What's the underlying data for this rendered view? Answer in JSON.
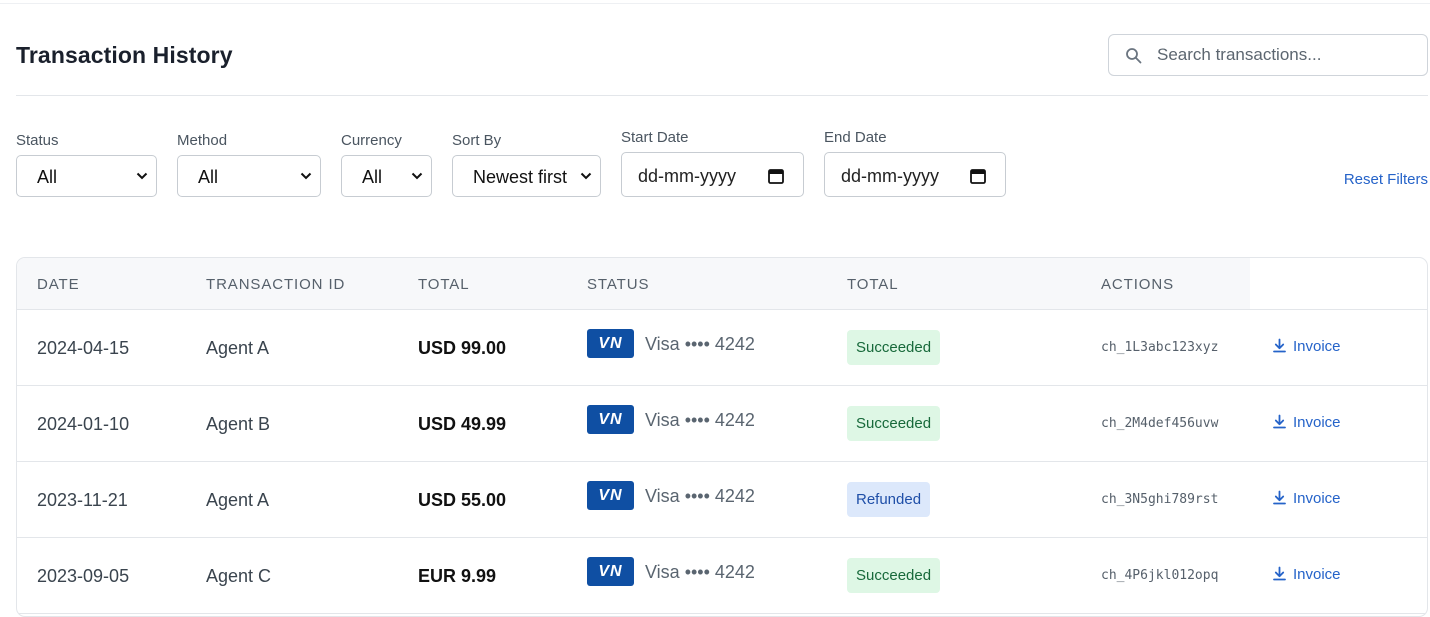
{
  "header": {
    "title": "Transaction History",
    "search_placeholder": "Search transactions..."
  },
  "filters": {
    "status": {
      "label": "Status",
      "value": "All"
    },
    "method": {
      "label": "Method",
      "value": "All"
    },
    "currency": {
      "label": "Currency",
      "value": "All"
    },
    "sort": {
      "label": "Sort By",
      "value": "Newest first"
    },
    "start_date": {
      "label": "Start Date",
      "value": "dd-mm-yyyy"
    },
    "end_date": {
      "label": "End Date",
      "value": "dd-mm-yyyy"
    },
    "reset_label": "Reset Filters"
  },
  "table": {
    "columns": [
      "DATE",
      "TRANSACTION ID",
      "TOTAL",
      "STATUS",
      "TOTAL",
      "ACTIONS"
    ],
    "rows": [
      {
        "date": "2024-04-15",
        "agent": "Agent A",
        "total": "USD 99.00",
        "card_brand": "VN",
        "card": "Visa •••• 4242",
        "status": "Succeeded",
        "charge_id": "ch_1L3abc123xyz",
        "action": "Invoice"
      },
      {
        "date": "2024-01-10",
        "agent": "Agent B",
        "total": "USD 49.99",
        "card_brand": "VN",
        "card": "Visa •••• 4242",
        "status": "Succeeded",
        "charge_id": "ch_2M4def456uvw",
        "action": "Invoice"
      },
      {
        "date": "2023-11-21",
        "agent": "Agent A",
        "total": "USD 55.00",
        "card_brand": "VN",
        "card": "Visa •••• 4242",
        "status": "Refunded",
        "charge_id": "ch_3N5ghi789rst",
        "action": "Invoice"
      },
      {
        "date": "2023-09-05",
        "agent": "Agent C",
        "total": "EUR 9.99",
        "card_brand": "VN",
        "card": "Visa •••• 4242",
        "status": "Succeeded",
        "charge_id": "ch_4P6jkl012opq",
        "action": "Invoice"
      }
    ]
  },
  "icons": {
    "search": "search-icon",
    "chevron": "chevron-down-icon",
    "calendar": "calendar-icon",
    "download": "download-icon"
  },
  "colors": {
    "accent": "#2563c9",
    "succeeded_bg": "#def7e5",
    "succeeded_text": "#17693a",
    "refunded_bg": "#dce8fb",
    "refunded_text": "#1f4fa8",
    "card_badge": "#0f4fa3"
  }
}
